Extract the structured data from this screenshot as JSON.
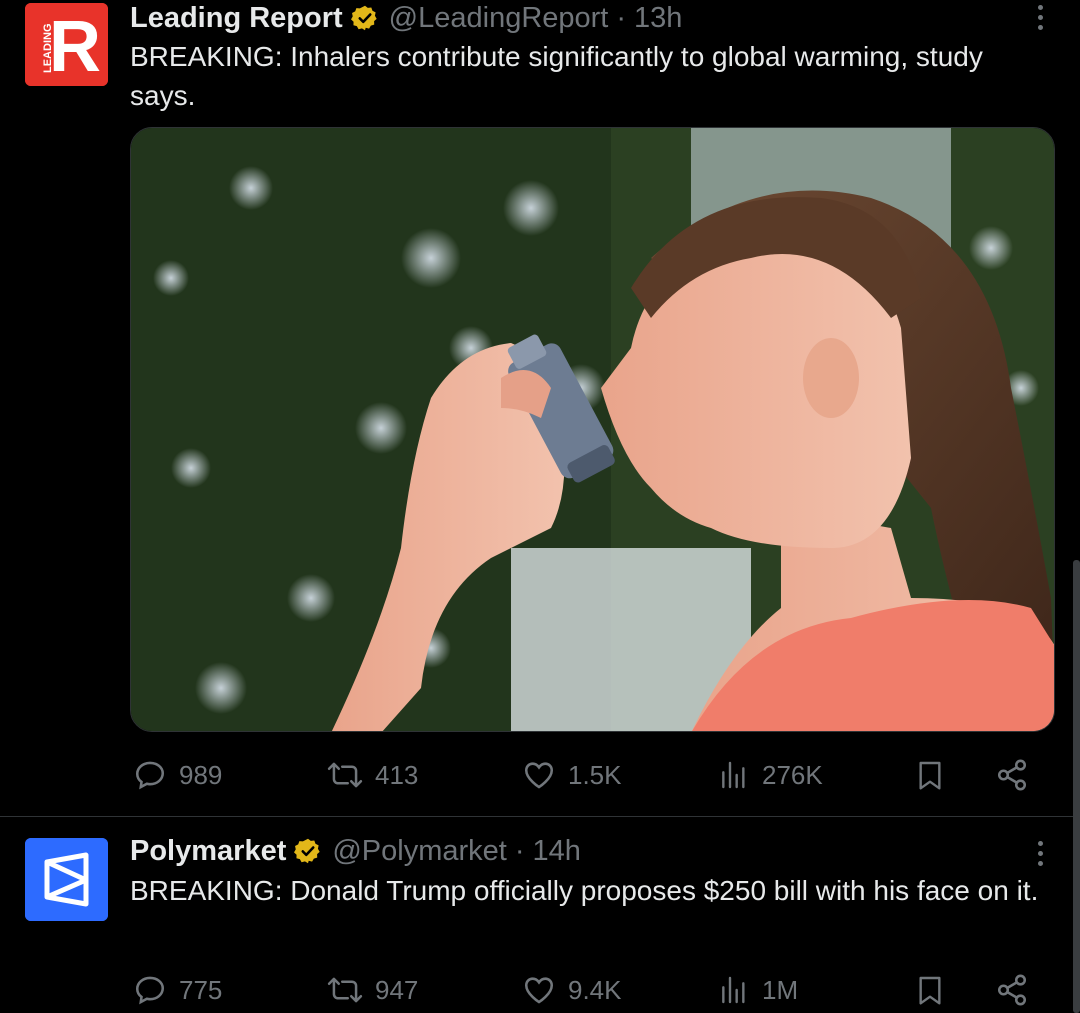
{
  "tweets": [
    {
      "author": {
        "name": "Leading Report",
        "handle": "@LeadingReport",
        "avatar_letter": "R",
        "avatar_side_text": "LEADING",
        "avatar_color": "#e8332a"
      },
      "separator": "·",
      "time": "13h",
      "text": "BREAKING: Inhalers contribute significantly to global warming, study says.",
      "image_description": "Young woman using an asthma inhaler outdoors in front of green trees",
      "stats": {
        "replies": "989",
        "reposts": "413",
        "likes": "1.5K",
        "views": "276K"
      }
    },
    {
      "author": {
        "name": "Polymarket",
        "handle": "@Polymarket",
        "avatar_color": "#2d6bff"
      },
      "separator": "·",
      "time": "14h",
      "text": "BREAKING: Donald Trump officially proposes $250 bill with his face on it.",
      "stats": {
        "replies": "775",
        "reposts": "947",
        "likes": "9.4K",
        "views": "1M"
      }
    }
  ],
  "colors": {
    "background": "#000000",
    "text": "#e7e9ea",
    "muted": "#71767b",
    "verified": "#e2b719",
    "divider": "#2f3336"
  }
}
